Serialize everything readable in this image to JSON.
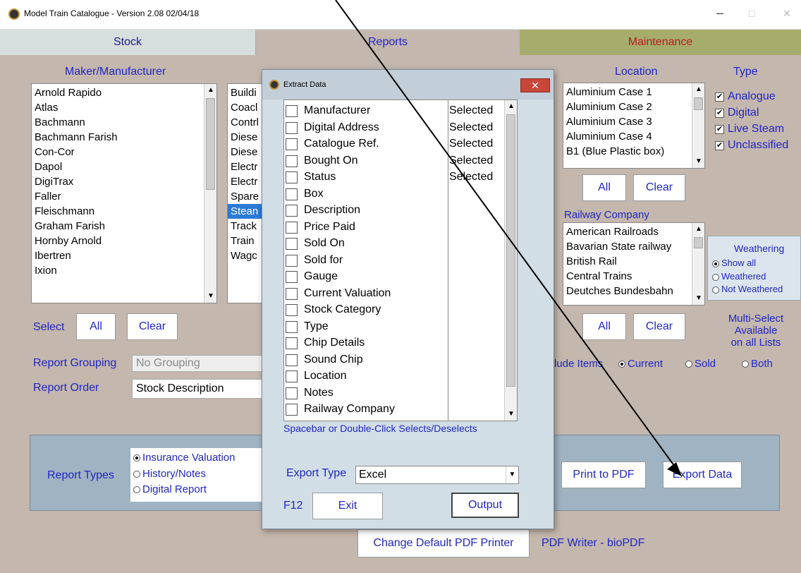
{
  "window": {
    "title": "Model Train Catalogue - Version 2.08  02/04/18",
    "minimize": "–",
    "maximize": "□",
    "close": "✕"
  },
  "tabs": [
    "Stock",
    "Reports",
    "Maintenance"
  ],
  "manufacturer": {
    "heading": "Maker/Manufacturer",
    "items": [
      "Arnold Rapido",
      "Atlas",
      "Bachmann",
      "Bachmann Farish",
      "Con-Cor",
      "Dapol",
      "DigiTrax",
      "Faller",
      "Fleischmann",
      "Graham Farish",
      "Hornby Arnold",
      "Ibertren",
      "Ixion"
    ]
  },
  "category": {
    "items": [
      "Buildi",
      "Coacl",
      "Contrl",
      "Diese",
      "Diese",
      "Electr",
      "Electr",
      "Spare",
      "Stean",
      "Track",
      "Train",
      "Wagc"
    ],
    "selected_index": 8
  },
  "select_row": {
    "label": "Select",
    "all": "All",
    "clear": "Clear"
  },
  "grouping": {
    "label": "Report Grouping",
    "value": "No Grouping"
  },
  "order": {
    "label": "Report Order",
    "value": "Stock Description"
  },
  "location": {
    "heading": "Location",
    "items": [
      "Aluminium Case 1",
      "Aluminium Case 2",
      "Aluminium Case 3",
      "Aluminium Case 4",
      "B1 (Blue Plastic box)"
    ],
    "all": "All",
    "clear": "Clear"
  },
  "type": {
    "heading": "Type",
    "items": [
      "Analogue",
      "Digital",
      "Live Steam",
      "Unclassified"
    ]
  },
  "railway": {
    "heading": "Railway Company",
    "items": [
      "American Railroads",
      "Bavarian State railway",
      "British Rail",
      "Central Trains",
      "Deutches Bundesbahn"
    ],
    "all": "All",
    "clear": "Clear"
  },
  "weathering": {
    "heading": "Weathering",
    "options": [
      "Show all",
      "Weathered",
      "Not Weathered"
    ]
  },
  "multiselect_note": [
    "Multi-Select",
    "Available",
    "on all Lists"
  ],
  "include_items": {
    "label": "lude Items",
    "options": [
      "Current",
      "Sold",
      "Both"
    ]
  },
  "report_types": {
    "label": "Report Types",
    "options": [
      "Insurance Valuation",
      "History/Notes",
      "Digital Report"
    ]
  },
  "print_pdf": "Print to PDF",
  "export_data": "Export Data",
  "change_printer": "Change Default PDF Printer",
  "pdf_writer": "PDF Writer - bioPDF",
  "dialog": {
    "title": "Extract Data",
    "close": "✕",
    "fields": [
      "Manufacturer",
      "Digital Address",
      "Catalogue Ref.",
      "Bought On",
      "Status",
      "Box",
      "Description",
      "Price Paid",
      "Sold On",
      "Sold for",
      "Gauge",
      "Current Valuation",
      "Stock Category",
      "Type",
      "Chip Details",
      "Sound Chip",
      "Location",
      "Notes",
      "Railway Company"
    ],
    "selected": [
      "Selected",
      "Selected",
      "Selected",
      "Selected",
      "Selected"
    ],
    "hint": "Spacebar or Double-Click Selects/Deselects",
    "export_type_label": "Export Type",
    "export_type_value": "Excel",
    "f12": "F12",
    "exit": "Exit",
    "output": "Output"
  }
}
